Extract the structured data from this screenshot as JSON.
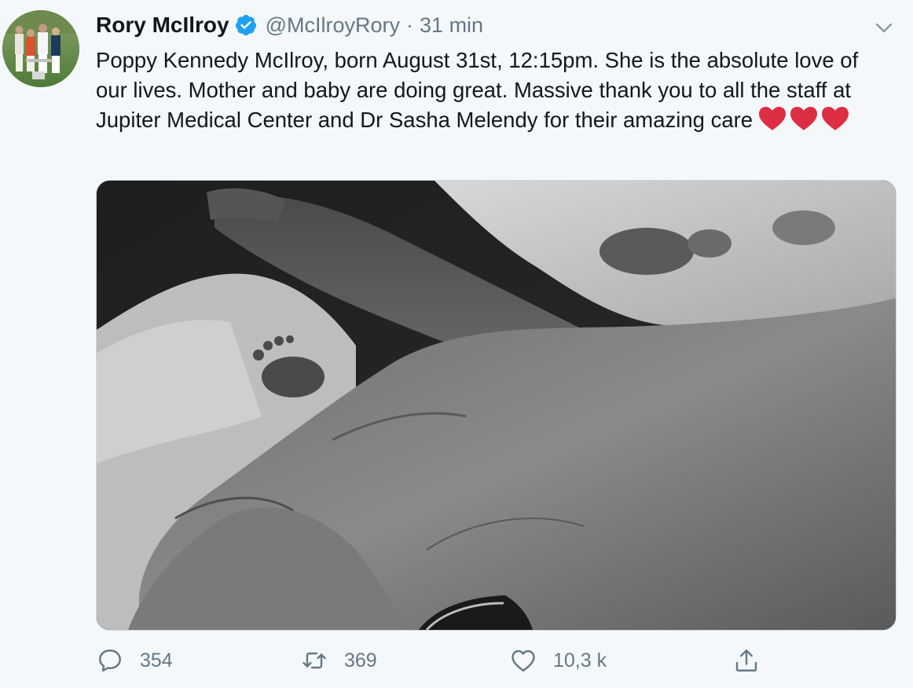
{
  "author": {
    "display_name": "Rory McIlroy",
    "handle": "@McIlroyRory",
    "separator": "·",
    "timestamp": "31 min",
    "verified": true,
    "verified_color": "#1da1f2"
  },
  "tweet": {
    "text": "Poppy Kennedy McIlroy, born August 31st, 12:15pm. She is the absolute love of our lives. Mother and baby are doing great. Massive thank you to all the staff at Jupiter Medical Center and Dr Sasha Melendy for their amazing care",
    "emoji": [
      "red-heart",
      "red-heart",
      "red-heart"
    ],
    "heart_color": "#dd2e44"
  },
  "media": {
    "type": "photo",
    "style": "black-and-white"
  },
  "actions": {
    "reply_count": "354",
    "retweet_count": "369",
    "like_count": "10,3 k",
    "icons": [
      "reply-icon",
      "retweet-icon",
      "like-icon",
      "share-icon"
    ]
  },
  "colors": {
    "background": "#f5f8fa",
    "secondary_text": "#657786",
    "primary_text": "#14171a"
  }
}
